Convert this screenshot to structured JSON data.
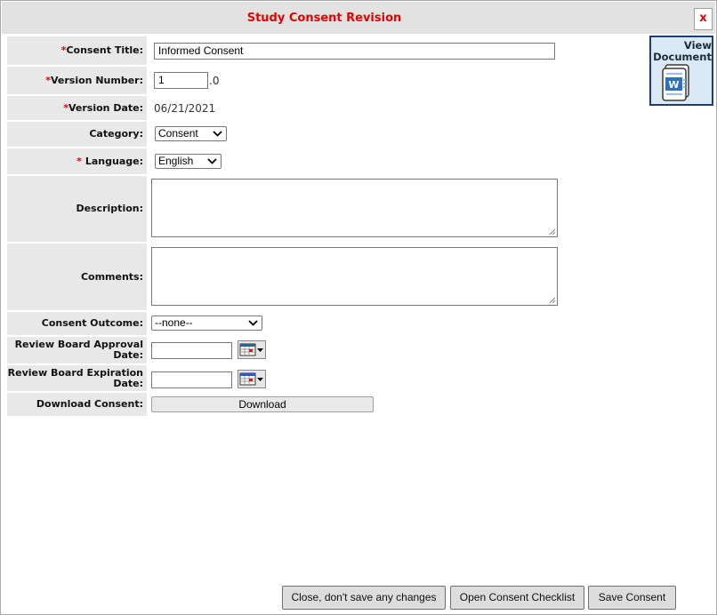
{
  "dialog": {
    "title": "Study Consent Revision",
    "close_label": "x"
  },
  "view_document": {
    "label": "View\nDocument",
    "icon": "word-document-icon"
  },
  "form": {
    "consent_title": {
      "label": "Consent Title:",
      "value": "Informed Consent",
      "required_mark": "*"
    },
    "version_number": {
      "label": "Version Number:",
      "value": "1",
      "suffix": ".0",
      "required_mark": "*"
    },
    "version_date": {
      "label": "Version Date:",
      "value": "06/21/2021",
      "required_mark": "*"
    },
    "category": {
      "label": "Category:",
      "value": "Consent"
    },
    "language": {
      "label": "Language:",
      "value": "English",
      "required_mark": "*"
    },
    "description": {
      "label": "Description:",
      "value": ""
    },
    "comments": {
      "label": "Comments:",
      "value": ""
    },
    "consent_outcome": {
      "label": "Consent Outcome:",
      "value": "--none--"
    },
    "approval_date": {
      "label_line1": "Review Board Approval",
      "label_line2": "Date:",
      "value": ""
    },
    "expiration_date": {
      "label_line1": "Review Board Expiration",
      "label_line2": "Date:",
      "value": ""
    },
    "download": {
      "label": "Download Consent:",
      "button": "Download"
    }
  },
  "footer": {
    "close_button": "Close, don't save any changes",
    "checklist_button": "Open Consent Checklist",
    "save_button": "Save Consent"
  },
  "colors": {
    "title_red": "#e80000",
    "label_bg": "#e8e8e8",
    "titlebar_bg": "#e2e2e2",
    "view_doc_border": "#1f3d6e"
  }
}
